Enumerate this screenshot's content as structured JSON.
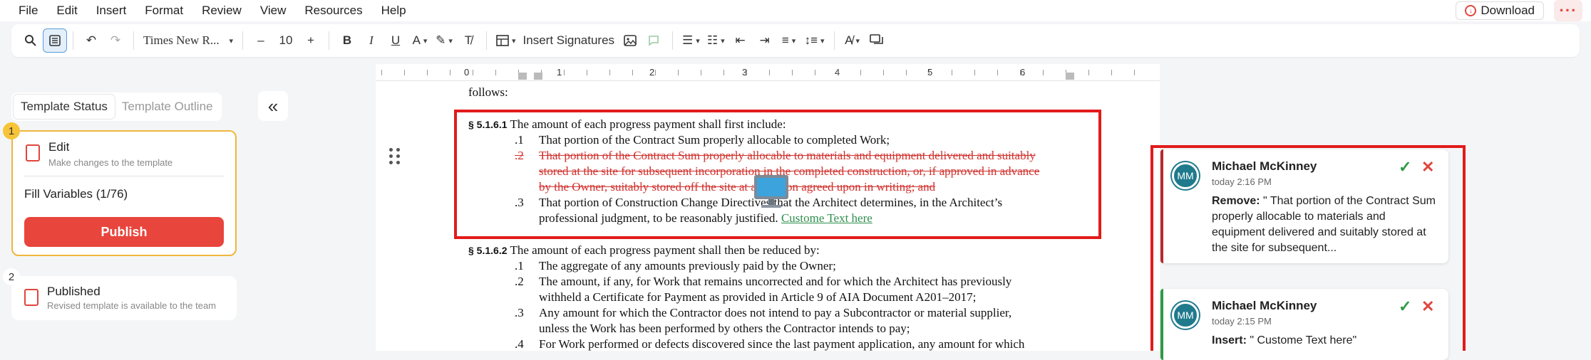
{
  "menu": {
    "items": [
      "File",
      "Edit",
      "Insert",
      "Format",
      "Review",
      "View",
      "Resources",
      "Help"
    ],
    "download_label": "Download",
    "more_label": "···"
  },
  "toolbar": {
    "font_family": "Times New R...",
    "font_size": "10",
    "minus": "–",
    "plus": "+",
    "bold": "B",
    "italic": "I",
    "underline": "U",
    "font_color": "A",
    "insert_signatures": "Insert Signatures"
  },
  "sidebar": {
    "tabs": [
      "Template Status",
      "Template Outline"
    ],
    "steps": [
      {
        "number": "1",
        "title": "Edit",
        "subtitle": "Make changes to the template",
        "fill_variables": "Fill Variables (1/76)",
        "publish_label": "Publish"
      },
      {
        "number": "2",
        "title": "Published",
        "subtitle": "Revised template is available to the team"
      }
    ],
    "collapse_icon": "«"
  },
  "ruler": {
    "labels": [
      "0",
      "1",
      "2",
      "3",
      "4",
      "5",
      "6"
    ]
  },
  "document": {
    "lead": "follows:",
    "section_1": {
      "number": "§ 5.1.6.1",
      "text": "The amount of each progress payment shall first include:",
      "items": [
        {
          "num": ".1",
          "text": "That portion of the Contract Sum properly allocable to completed Work;"
        },
        {
          "num": ".2",
          "lines": [
            "That portion of the Contract Sum properly allocable to materials and equipment delivered and suitably",
            "stored at the site for subsequent incorporation in the completed construction, or, if approved in advance",
            "by the Owner, suitably stored off the site at a location agreed upon in writing; and"
          ]
        },
        {
          "num": ".3",
          "lines": [
            "That portion of Construction Change Directives that the Architect determines, in the Architect’s",
            "professional judgment, to be reasonably justified."
          ],
          "inserted": "Custome Text here"
        }
      ]
    },
    "section_2": {
      "number": "§ 5.1.6.2",
      "text": "The amount of each progress payment shall then be reduced by:",
      "items": [
        {
          "num": ".1",
          "lines": [
            "The aggregate of any amounts previously paid by the Owner;"
          ]
        },
        {
          "num": ".2",
          "lines": [
            "The amount, if any, for Work that remains uncorrected and for which the Architect has previously",
            "withheld a Certificate for Payment as provided in Article 9 of AIA Document A201–2017;"
          ]
        },
        {
          "num": ".3",
          "lines": [
            "Any amount for which the Contractor does not intend to pay a Subcontractor or material supplier,",
            "unless the Work has been performed by others the Contractor intends to pay;"
          ]
        },
        {
          "num": ".4",
          "lines": [
            "For Work performed or defects discovered since the last payment application, any amount for which"
          ]
        }
      ]
    }
  },
  "comments": [
    {
      "initials": "MM",
      "author": "Michael McKinney",
      "time": "today 2:16 PM",
      "action": "Remove:",
      "text": " \"     That portion of the Contract Sum properly allocable to materials and equipment delivered and suitably stored at the site for subsequent...",
      "bar_color": "#b9282a"
    },
    {
      "initials": "MM",
      "author": "Michael McKinney",
      "time": "today 2:15 PM",
      "action": "Insert:",
      "text": " \" Custome Text here\"",
      "bar_color": "#2e9a44"
    }
  ],
  "colors": {
    "accent_red": "#e8453c",
    "highlight_red": "#e21b1b",
    "step_active_border": "#f0b63d",
    "inserted_green": "#2f8f4e"
  }
}
